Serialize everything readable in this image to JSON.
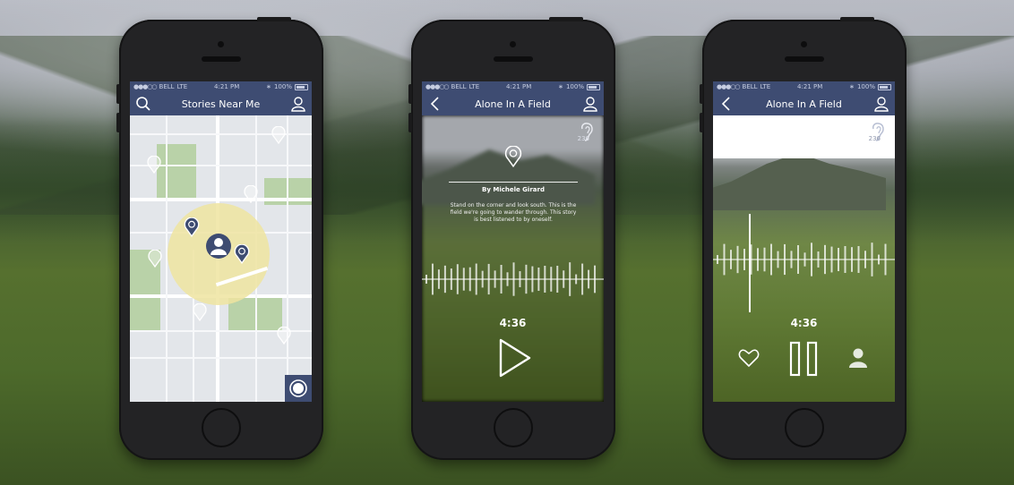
{
  "colors": {
    "accent": "#3e4c72",
    "map_radius": "#eee4a0",
    "pin": "#3e4c72"
  },
  "status": {
    "carrier": "BELL",
    "network": "LTE",
    "time": "4:21 PM",
    "battery": "100%"
  },
  "screen1": {
    "title": "Stories Near Me",
    "left_icon": "search-icon",
    "right_icon": "user-icon",
    "record_icon": "record-icon"
  },
  "screen2": {
    "title": "Alone In A Field",
    "left_icon": "back-icon",
    "right_icon": "user-icon",
    "listen_count": "236",
    "author": "By Michele Girard",
    "description": "Stand on the corner and look south. This is the field we're going to wander through. This story is best listened to by oneself.",
    "duration": "4:36",
    "control_icon": "play-icon"
  },
  "screen3": {
    "title": "Alone In A Field",
    "left_icon": "back-icon",
    "right_icon": "user-icon",
    "listen_count": "236",
    "duration": "4:36",
    "controls": [
      "heart-icon",
      "pause-icon",
      "user-icon"
    ]
  }
}
